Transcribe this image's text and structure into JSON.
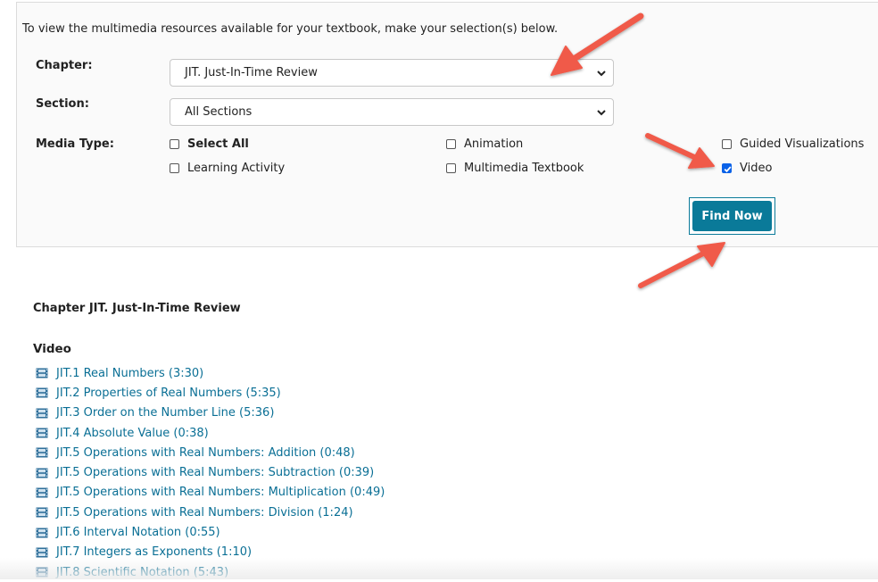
{
  "form": {
    "intro": "To view the multimedia resources available for your textbook, make your selection(s) below.",
    "chapter_label": "Chapter:",
    "chapter_value": "JIT. Just-In-Time Review",
    "section_label": "Section:",
    "section_value": "All Sections",
    "media_type_label": "Media Type:",
    "media_types": [
      {
        "label": "Select All",
        "checked": false
      },
      {
        "label": "Animation",
        "checked": false
      },
      {
        "label": "Guided Visualizations",
        "checked": false
      },
      {
        "label": "Learning Activity",
        "checked": false
      },
      {
        "label": "Multimedia Textbook",
        "checked": false
      },
      {
        "label": "Video",
        "checked": true
      }
    ],
    "find_button": "Find Now"
  },
  "results": {
    "chapter_heading": "Chapter JIT. Just-In-Time Review",
    "section_heading": "Video",
    "icon": "film-icon",
    "items": [
      "JIT.1 Real Numbers (3:30)",
      "JIT.2 Properties of Real Numbers (5:35)",
      "JIT.3 Order on the Number Line (5:36)",
      "JIT.4 Absolute Value (0:38)",
      "JIT.5 Operations with Real Numbers: Addition (0:48)",
      "JIT.5 Operations with Real Numbers: Subtraction (0:39)",
      "JIT.5 Operations with Real Numbers: Multiplication (0:49)",
      "JIT.5 Operations with Real Numbers: Division (1:24)",
      "JIT.6 Interval Notation (0:55)",
      "JIT.7 Integers as Exponents (1:10)",
      "JIT.8 Scientific Notation (5:43)"
    ]
  },
  "colors": {
    "accent": "#0a7a99",
    "link": "#0a6f95",
    "annotation_arrow": "#f05a4a",
    "checkbox_checked": "#0b62e8"
  }
}
